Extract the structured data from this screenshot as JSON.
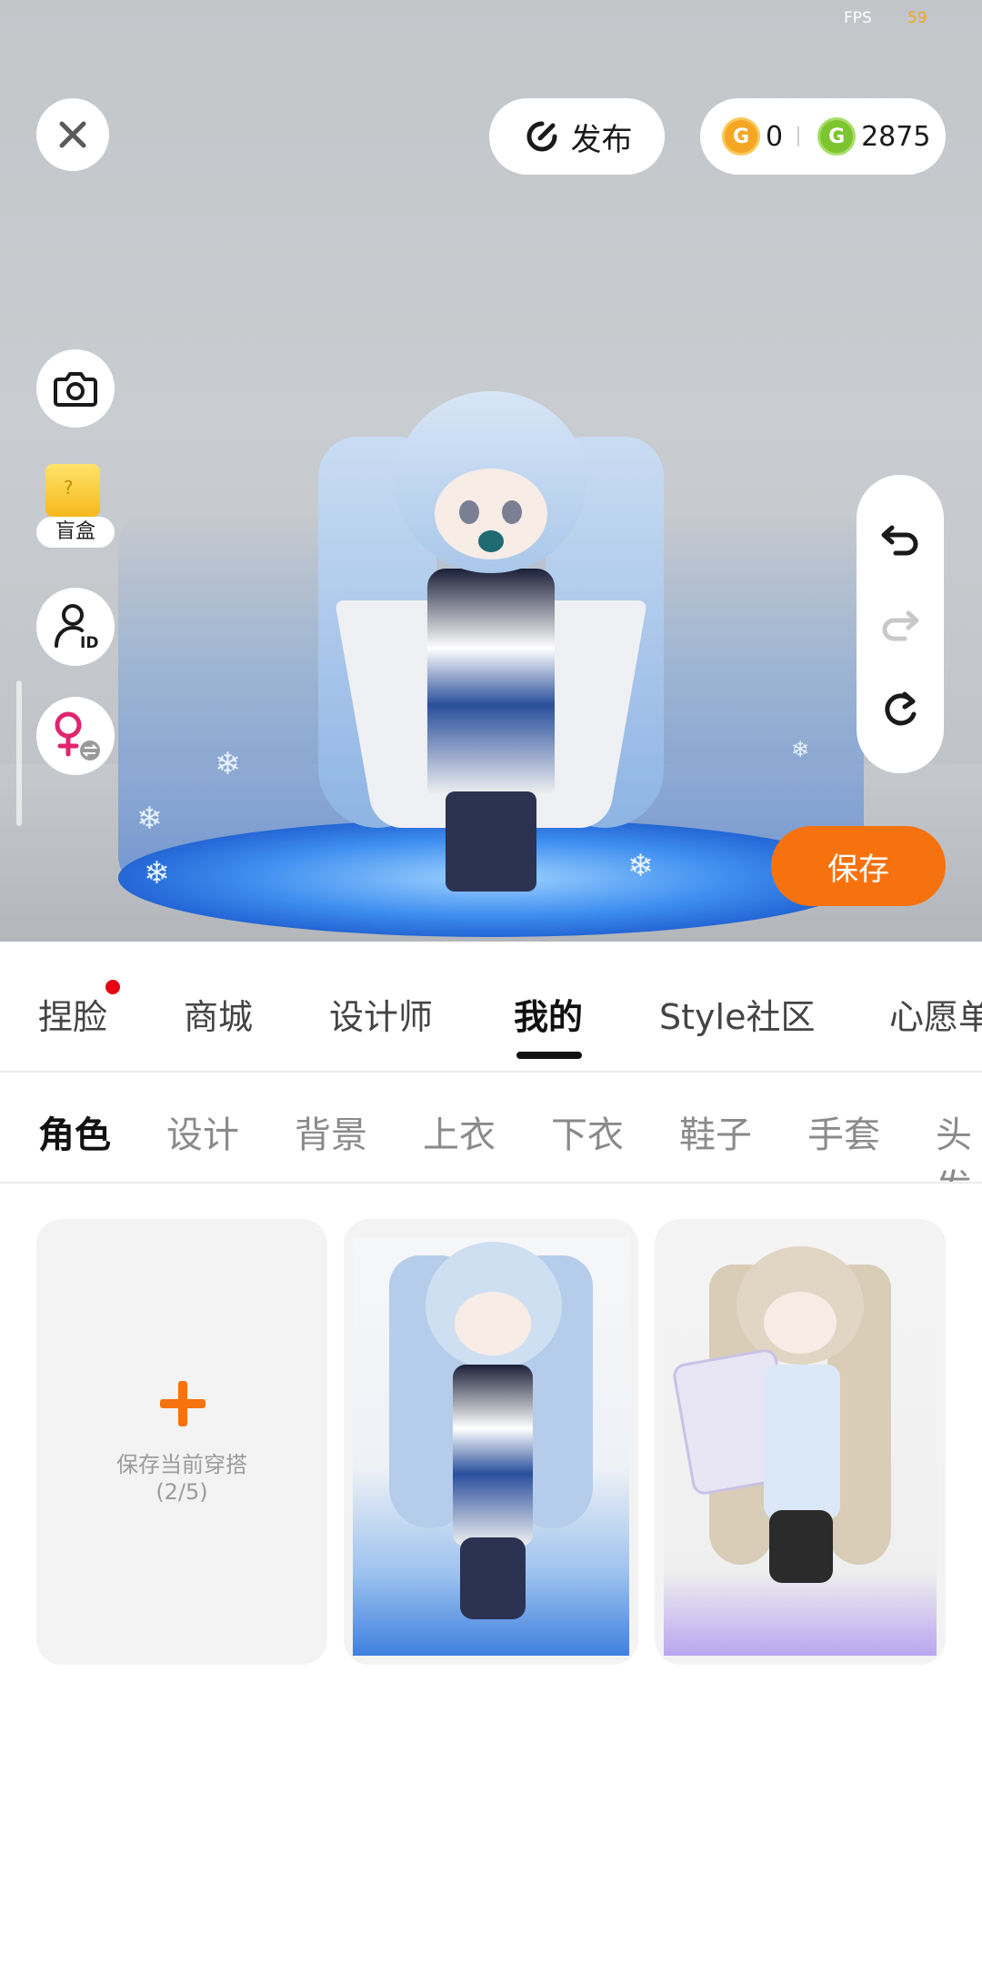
{
  "status": {
    "fps_label": "FPS",
    "fps_value": "59"
  },
  "top_bar": {
    "close_icon": "close-icon",
    "publish_label": "发布",
    "currency": {
      "gold_amount": "0",
      "green_amount": "2875",
      "gold_symbol": "G",
      "green_symbol": "G"
    }
  },
  "side_tools": {
    "camera_icon": "camera-icon",
    "blindbox_label": "盲盒",
    "blindbox_symbol": "?",
    "id_icon": "avatar-id-icon",
    "gender_icon": "female-swap-icon"
  },
  "history": {
    "undo": "undo-icon",
    "redo": "redo-icon",
    "reset": "reset-icon"
  },
  "save_label": "保存",
  "main_tabs": [
    {
      "label": "捏脸",
      "badge": true
    },
    {
      "label": "商城"
    },
    {
      "label": "设计师"
    },
    {
      "label": "我的",
      "active": true
    },
    {
      "label": "Style社区"
    },
    {
      "label": "心愿单"
    }
  ],
  "sub_tabs": [
    {
      "label": "角色",
      "active": true
    },
    {
      "label": "设计"
    },
    {
      "label": "背景"
    },
    {
      "label": "上衣"
    },
    {
      "label": "下衣"
    },
    {
      "label": "鞋子"
    },
    {
      "label": "手套"
    },
    {
      "label": "头发"
    }
  ],
  "outfits": {
    "add_label": "保存当前穿搭",
    "add_count": "(2/5)"
  },
  "colors": {
    "accent": "#f6720f",
    "badge": "#e60012",
    "gold": "#f5a623",
    "green": "#7dc52e"
  }
}
